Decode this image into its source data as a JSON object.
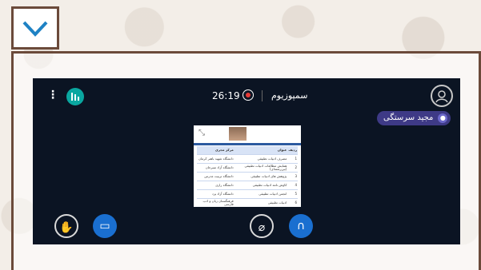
{
  "header": {
    "collapse_icon": "chevron-down-icon"
  },
  "meeting": {
    "timer": "26:19",
    "title": "سمپوزیوم",
    "speaker_name": "مجید سرستگی",
    "record_color": "#e53935",
    "accent": "#1a6fd0",
    "speaker_chip_color": "#3e3a86"
  },
  "toolbar": {
    "menu_icon": "more-vertical-icon",
    "stats_icon": "bar-chart-icon",
    "avatar_icon": "user-circle-icon",
    "hand_icon": "hand-raise-icon",
    "present_icon": "presentation-icon",
    "camera_icon": "camera-off-icon",
    "audio_icon": "headphones-icon"
  },
  "slide": {
    "headers": [
      "ردیف",
      "عنوان",
      "مرکز مجری"
    ],
    "rows": [
      [
        "1",
        "مصرف ادبیات تطبیقی",
        "دانشگاه شهید باهنر کرمان"
      ],
      [
        "2",
        "همایش مطالعات ادبیات تطبیقی (بین‌رشته‌ای)",
        "دانشگاه آزاد سیرجان"
      ],
      [
        "3",
        "پژوهش های ادبیات تطبیقی",
        "دانشگاه تربیت مدرس"
      ],
      [
        "4",
        "کاوش نامه ادبیات تطبیقی",
        "دانشگاه رازی"
      ],
      [
        "5",
        "انجمن ادبیات تطبیقی",
        "دانشگاه آزاد یزد"
      ],
      [
        "6",
        "ادبیات تطبیقی",
        "فرهنگستان زبان و ادب فارسی"
      ]
    ]
  }
}
